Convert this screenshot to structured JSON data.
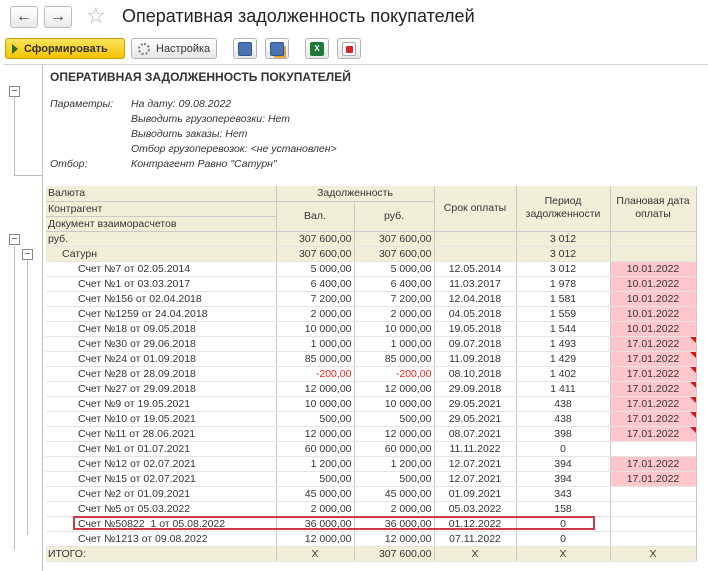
{
  "window": {
    "title": "Оперативная задолженность покупателей"
  },
  "toolbar": {
    "generate_label": "Сформировать",
    "settings_label": "Настройка"
  },
  "report": {
    "title": "ОПЕРАТИВНАЯ ЗАДОЛЖЕННОСТЬ ПОКУПАТЕЛЕЙ",
    "params_label": "Параметры:",
    "params": [
      "На дату: 09.08.2022",
      "Выводить грузоперевозки: Нет",
      "Выводить заказы: Нет",
      "Отбор грузоперевозок: <не установлен>"
    ],
    "filter_label": "Отбор:",
    "filter_value": "Контрагент Равно \"Сатурн\""
  },
  "table": {
    "headers": {
      "currency": "Валюта",
      "counterparty": "Контрагент",
      "document": "Документ взаиморасчетов",
      "debt": "Задолженность",
      "val": "Вал.",
      "rub": "руб.",
      "due": "Срок оплаты",
      "period": "Период задолженности",
      "planned": "Плановая дата оплаты"
    },
    "group": {
      "name": "руб.",
      "val": "307 600,00",
      "rub": "307 600,00",
      "period": "3 012"
    },
    "subgroup": {
      "name": "Сатурн",
      "val": "307 600,00",
      "rub": "307 600,00",
      "period": "3 012"
    },
    "rows": [
      {
        "doc": "Счет №7 от 02.05.2014",
        "val": "5 000,00",
        "rub": "5 000,00",
        "due": "12.05.2014",
        "period": "3 012",
        "planned": "10.01.2022",
        "mark": false
      },
      {
        "doc": "Счет №1 от 03.03.2017",
        "val": "6 400,00",
        "rub": "6 400,00",
        "due": "11.03.2017",
        "period": "1 978",
        "planned": "10.01.2022",
        "mark": false
      },
      {
        "doc": "Счет №156 от 02.04.2018",
        "val": "7 200,00",
        "rub": "7 200,00",
        "due": "12.04.2018",
        "period": "1 581",
        "planned": "10.01.2022",
        "mark": false
      },
      {
        "doc": "Счет №1259 от 24.04.2018",
        "val": "2 000,00",
        "rub": "2 000,00",
        "due": "04.05.2018",
        "period": "1 559",
        "planned": "10.01.2022",
        "mark": false
      },
      {
        "doc": "Счет №18 от 09.05.2018",
        "val": "10 000,00",
        "rub": "10 000,00",
        "due": "19.05.2018",
        "period": "1 544",
        "planned": "10.01.2022",
        "mark": false
      },
      {
        "doc": "Счет №30 от 29.06.2018",
        "val": "1 000,00",
        "rub": "1 000,00",
        "due": "09.07.2018",
        "period": "1 493",
        "planned": "17.01.2022",
        "mark": true
      },
      {
        "doc": "Счет №24 от 01.09.2018",
        "val": "85 000,00",
        "rub": "85 000,00",
        "due": "11.09.2018",
        "period": "1 429",
        "planned": "17.01.2022",
        "mark": true
      },
      {
        "doc": "Счет №28 от 28.09.2018",
        "val": "-200,00",
        "rub": "-200,00",
        "due": "08.10.2018",
        "period": "1 402",
        "planned": "17.01.2022",
        "mark": true,
        "neg": true
      },
      {
        "doc": "Счет №27 от 29.09.2018",
        "val": "12 000,00",
        "rub": "12 000,00",
        "due": "29.09.2018",
        "period": "1 411",
        "planned": "17.01.2022",
        "mark": true
      },
      {
        "doc": "Счет №9 от 19.05.2021",
        "val": "10 000,00",
        "rub": "10 000,00",
        "due": "29.05.2021",
        "period": "438",
        "planned": "17.01.2022",
        "mark": true
      },
      {
        "doc": "Счет №10 от 19.05.2021",
        "val": "500,00",
        "rub": "500,00",
        "due": "29.05.2021",
        "period": "438",
        "planned": "17.01.2022",
        "mark": true
      },
      {
        "doc": "Счет №11 от 28.06.2021",
        "val": "12 000,00",
        "rub": "12 000,00",
        "due": "08.07.2021",
        "period": "398",
        "planned": "17.01.2022",
        "mark": true
      },
      {
        "doc": "Счет №1 от 01.07.2021",
        "val": "60 000,00",
        "rub": "60 000,00",
        "due": "11.11.2022",
        "period": "0",
        "planned": "",
        "mark": false
      },
      {
        "doc": "Счет №12 от 02.07.2021",
        "val": "1 200,00",
        "rub": "1 200,00",
        "due": "12.07.2021",
        "period": "394",
        "planned": "17.01.2022",
        "mark": false
      },
      {
        "doc": "Счет №15 от 02.07.2021",
        "val": "500,00",
        "rub": "500,00",
        "due": "12.07.2021",
        "period": "394",
        "planned": "17.01.2022",
        "mark": false
      },
      {
        "doc": "Счет №2 от 01.09.2021",
        "val": "45 000,00",
        "rub": "45 000,00",
        "due": "01.09.2021",
        "period": "343",
        "planned": "",
        "mark": false
      },
      {
        "doc": "Счет №5 от 05.03.2022",
        "val": "2 000,00",
        "rub": "2 000,00",
        "due": "05.03.2022",
        "period": "158",
        "planned": "",
        "mark": false
      },
      {
        "doc": "Счет №50822_1 от 05.08.2022",
        "val": "36 000,00",
        "rub": "36 000,00",
        "due": "01.12.2022",
        "period": "0",
        "planned": "",
        "mark": false
      },
      {
        "doc": "Счет №1213 от 09.08.2022",
        "val": "12 000,00",
        "rub": "12 000,00",
        "due": "07.11.2022",
        "period": "0",
        "planned": "",
        "mark": false
      }
    ],
    "total": {
      "label": "ИТОГО:",
      "val": "X",
      "rub": "307 600,00",
      "due": "X",
      "period": "X",
      "planned": "X"
    }
  },
  "colors": {
    "accent_button": "#f3c200",
    "header_bg": "#f2efd9",
    "overdue_bg": "#ffc6cc",
    "negative": "#e22",
    "highlight_box": "#cf3a48"
  }
}
